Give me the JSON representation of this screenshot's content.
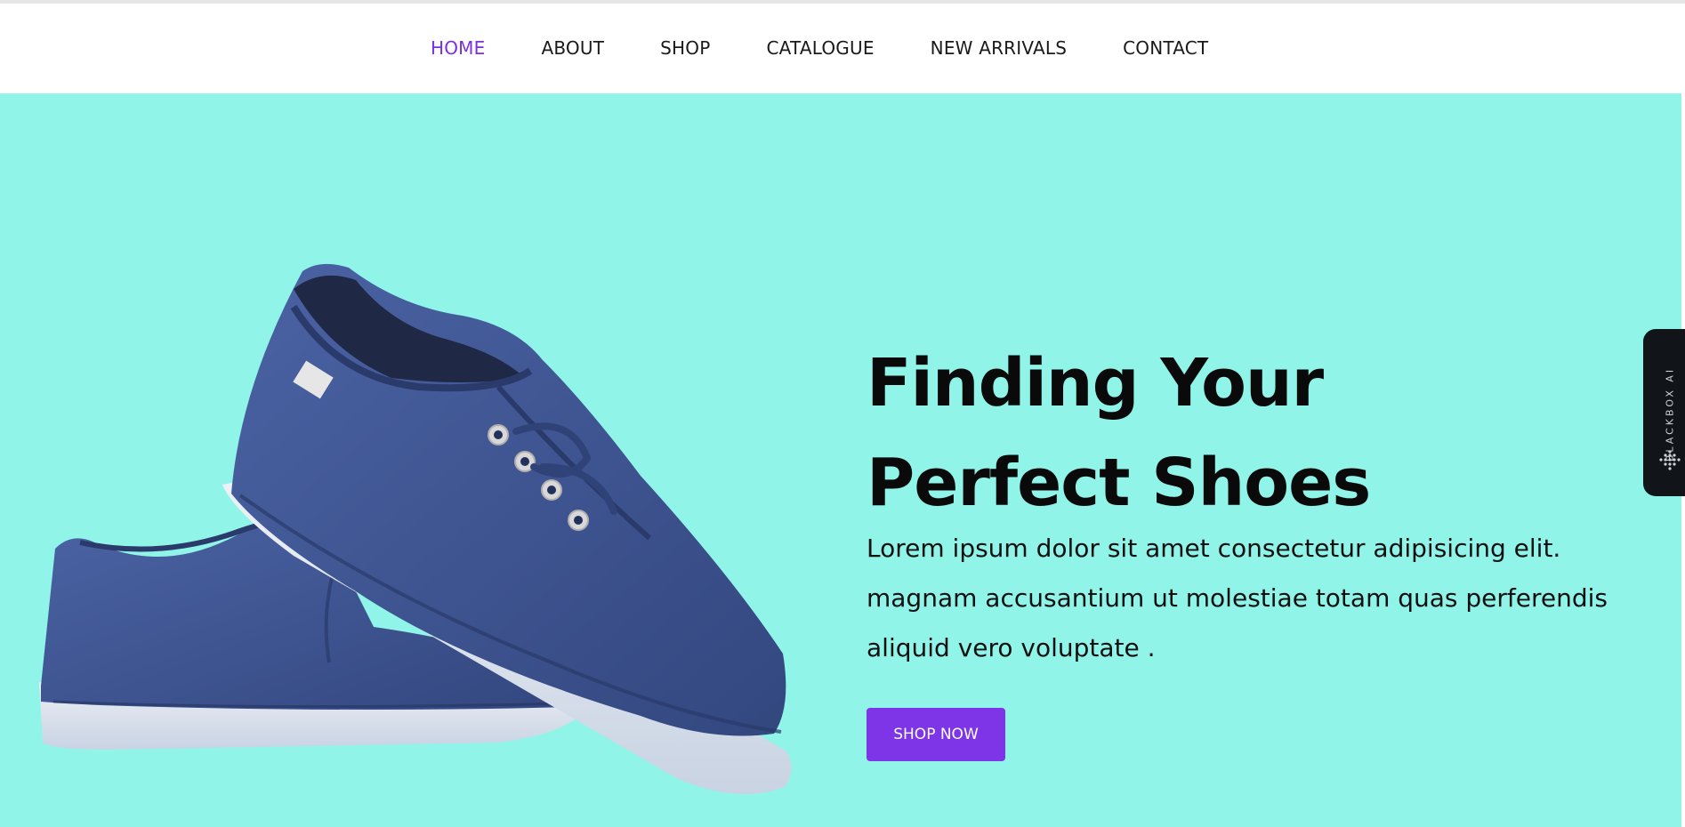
{
  "nav": {
    "items": [
      {
        "label": "HOME",
        "active": true
      },
      {
        "label": "ABOUT",
        "active": false
      },
      {
        "label": "SHOP",
        "active": false
      },
      {
        "label": "CATALOGUE",
        "active": false
      },
      {
        "label": "NEW ARRIVALS",
        "active": false
      },
      {
        "label": "CONTACT",
        "active": false
      }
    ]
  },
  "hero": {
    "headline_line1": "Finding Your",
    "headline_line2": "Perfect Shoes",
    "desc_line1": "Lorem ipsum dolor sit amet consectetur adipisicing elit.",
    "desc_line2": "magnam accusantium ut molestiae totam quas perferendis",
    "desc_line3": "aliquid vero voluptate .",
    "cta_label": "SHOP NOW",
    "image_icon": "sneakers-image"
  },
  "sidebar_widget": {
    "label": "BLACKBOX AI",
    "icon": "dots-icon"
  },
  "colors": {
    "accent": "#7e35e7",
    "nav_active": "#7b2fe0",
    "hero_bg": "#90f4e8",
    "shoe_canvas": "#3d5594",
    "shoe_sole": "#dfe6f0"
  }
}
